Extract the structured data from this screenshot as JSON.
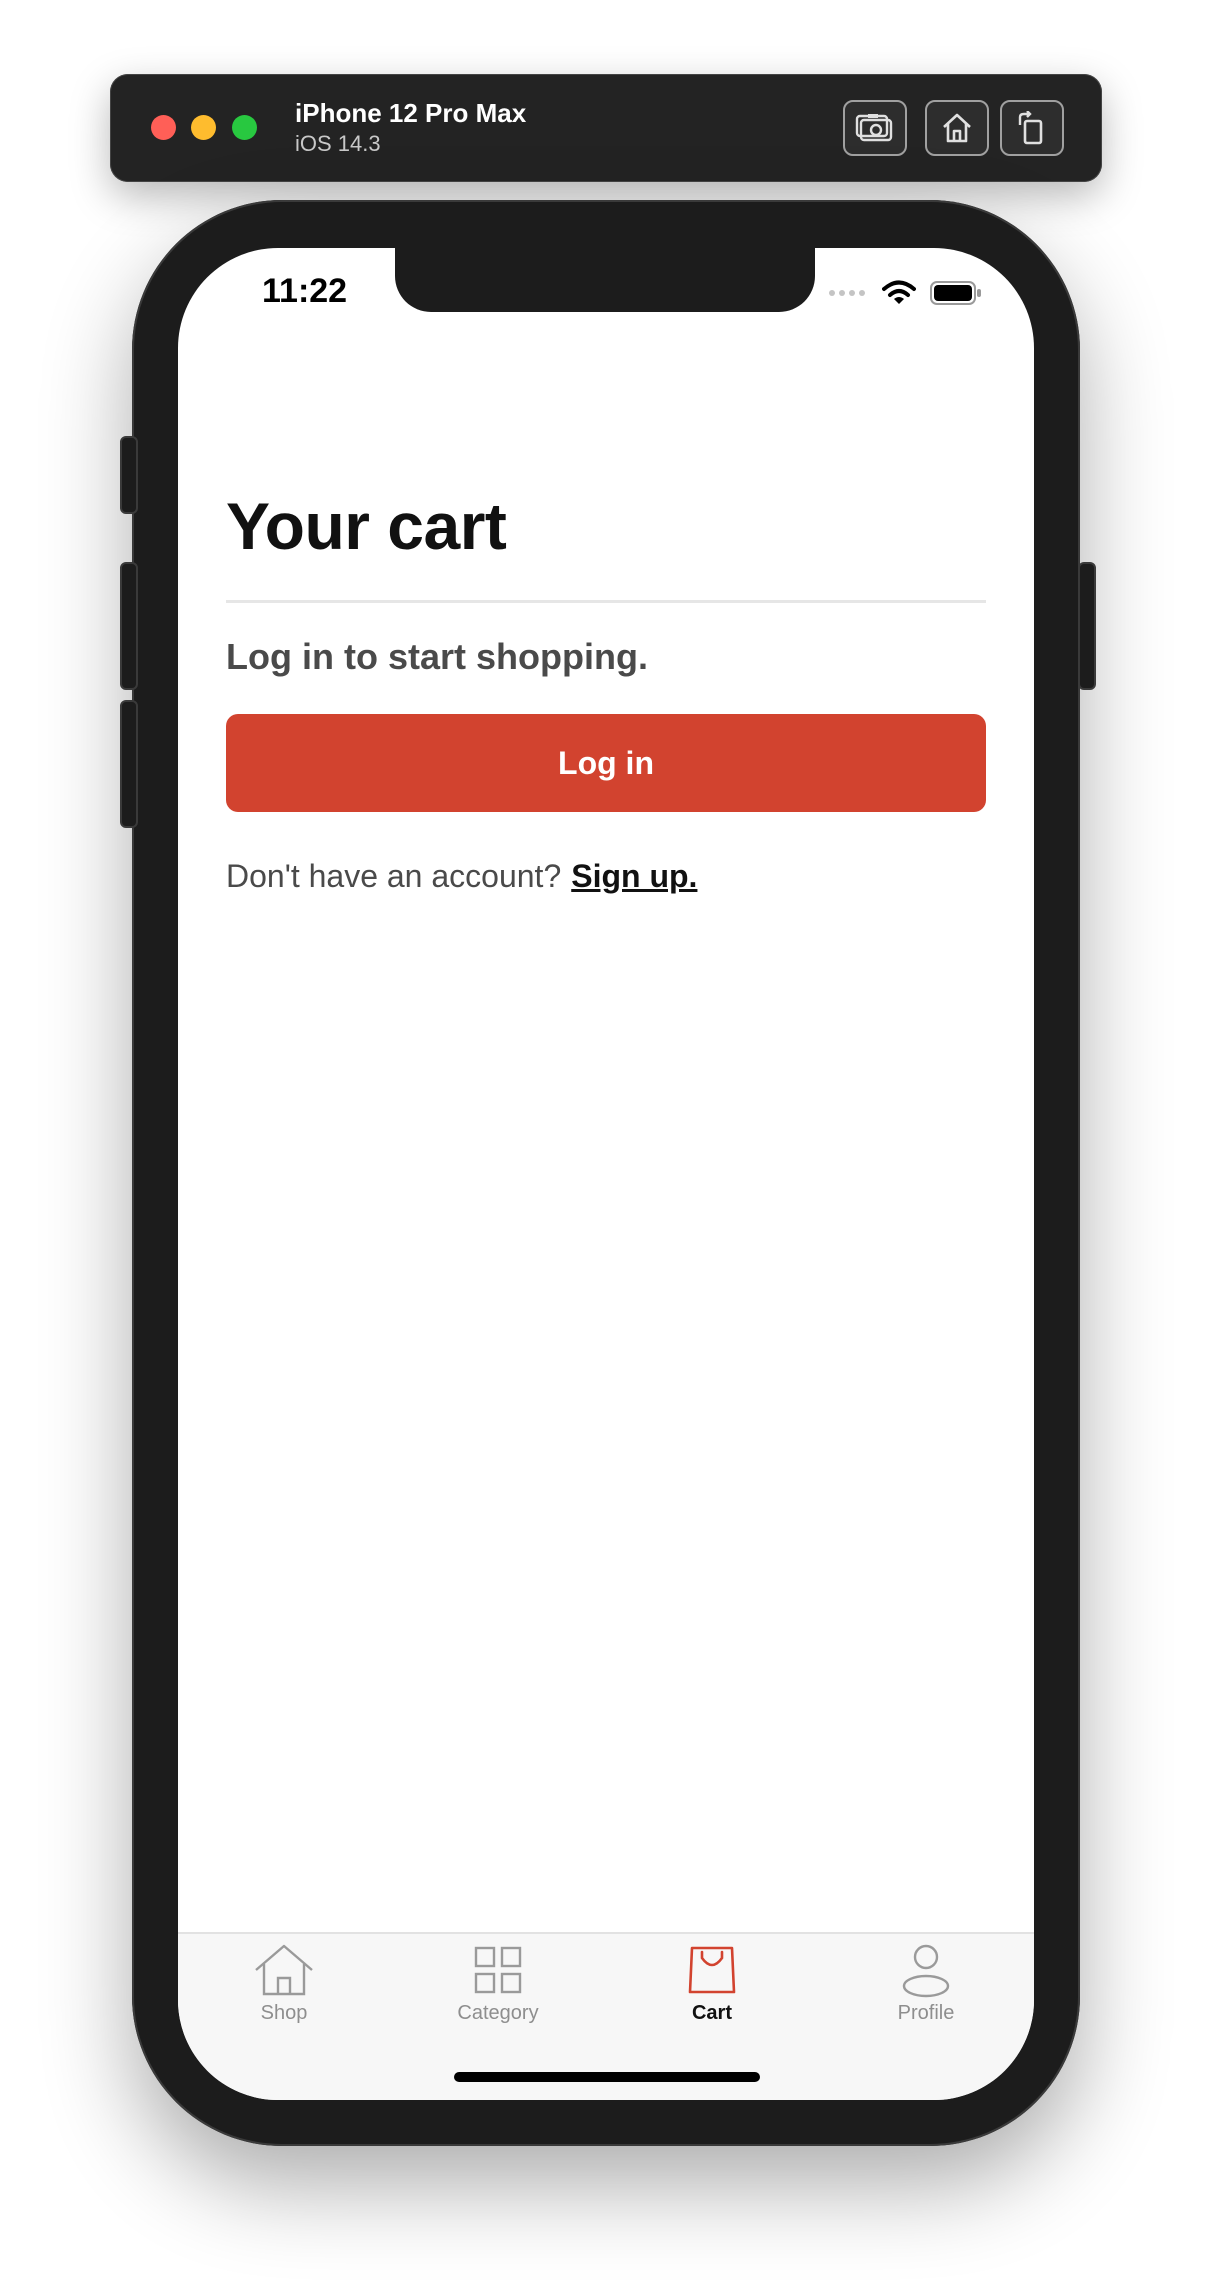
{
  "simulator": {
    "device_name": "iPhone 12 Pro Max",
    "os_version": "iOS 14.3"
  },
  "status_bar": {
    "time": "11:22"
  },
  "cart": {
    "title": "Your cart",
    "subtitle": "Log in to start shopping.",
    "login_label": "Log in",
    "no_account_text": "Don't have an account?",
    "signup_label": "Sign up."
  },
  "tabs": [
    {
      "label": "Shop",
      "icon": "house-icon",
      "active": false
    },
    {
      "label": "Category",
      "icon": "grid-icon",
      "active": false
    },
    {
      "label": "Cart",
      "icon": "shopping-bag-icon",
      "active": true
    },
    {
      "label": "Profile",
      "icon": "person-icon",
      "active": false
    }
  ],
  "colors": {
    "accent": "#d2432f",
    "tab_inactive": "#8e8e8e",
    "tab_active": "#111111"
  }
}
